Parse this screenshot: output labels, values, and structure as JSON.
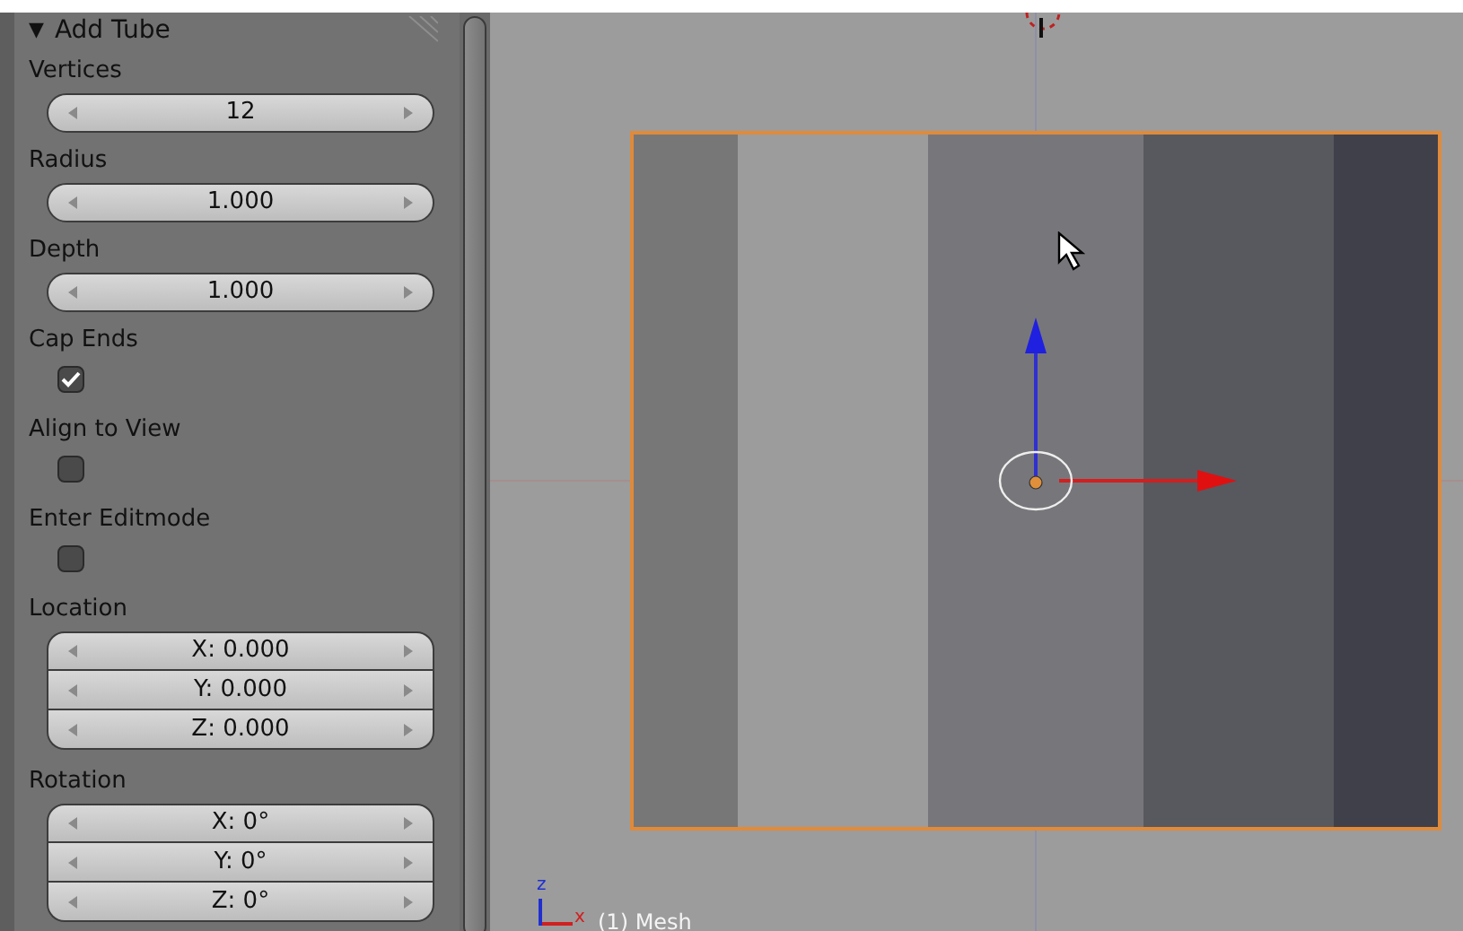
{
  "panel": {
    "arrow": "▼",
    "title": "Add Tube",
    "items": [
      {
        "kind": "number",
        "label": "Vertices",
        "value": "12"
      },
      {
        "kind": "number",
        "label": "Radius",
        "value": "1.000"
      },
      {
        "kind": "number",
        "label": "Depth",
        "value": "1.000"
      },
      {
        "kind": "checkbox",
        "label": "Cap Ends",
        "checked": true
      },
      {
        "kind": "checkbox",
        "label": "Align to View",
        "checked": false
      },
      {
        "kind": "checkbox",
        "label": "Enter Editmode",
        "checked": false
      },
      {
        "kind": "vector",
        "label": "Location",
        "values": [
          "X: 0.000",
          "Y: 0.000",
          "Z: 0.000"
        ]
      },
      {
        "kind": "vector",
        "label": "Rotation",
        "values": [
          "X: 0°",
          "Y: 0°",
          "Z: 0°"
        ]
      }
    ]
  },
  "viewport": {
    "axis_labels": [
      "z",
      "x"
    ],
    "object_label": "(1) Mesh"
  }
}
